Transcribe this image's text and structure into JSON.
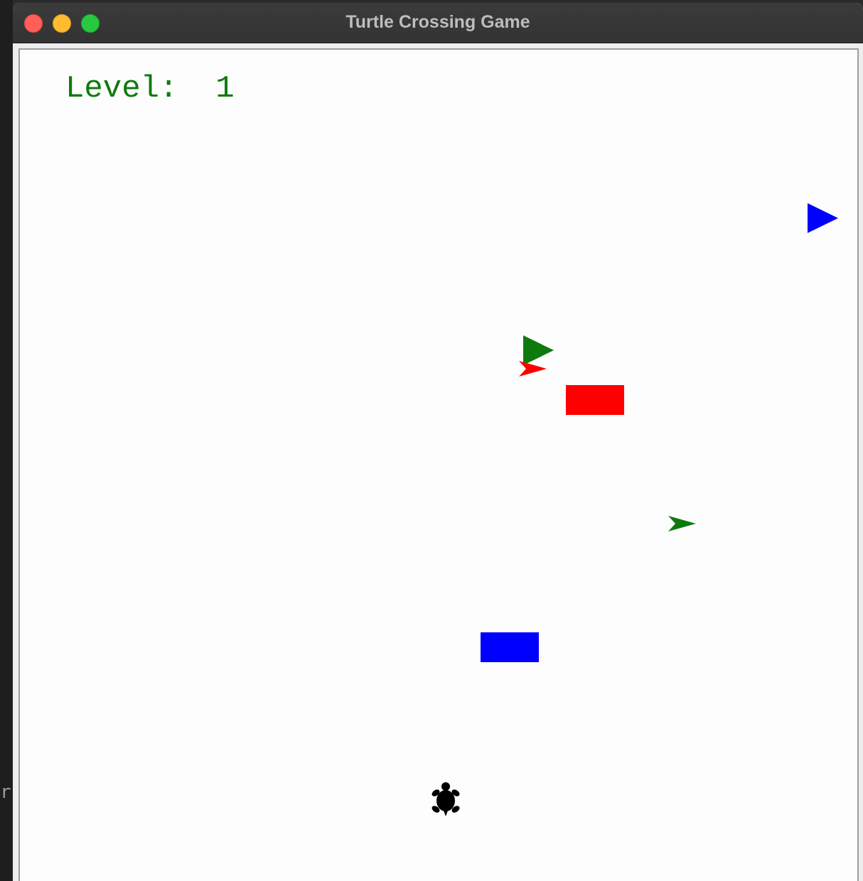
{
  "window": {
    "title": "Turtle Crossing Game",
    "controls": [
      "close",
      "minimize",
      "zoom"
    ]
  },
  "background_fragment": "r",
  "hud": {
    "level_label": "Level:",
    "level_value": "1",
    "level_text": "Level:  1",
    "color": "#0e7a0e"
  },
  "game": {
    "player": {
      "shape": "turtle",
      "color": "#000000",
      "heading": "up"
    },
    "cars": [
      {
        "shape": "triangle",
        "color": "#0000ff"
      },
      {
        "shape": "triangle",
        "color": "#0e7a0e"
      },
      {
        "shape": "arrow",
        "color": "#ff0000"
      },
      {
        "shape": "square",
        "color": "#ff0000"
      },
      {
        "shape": "arrow",
        "color": "#0e7a0e"
      },
      {
        "shape": "square",
        "color": "#0000ff"
      }
    ]
  }
}
